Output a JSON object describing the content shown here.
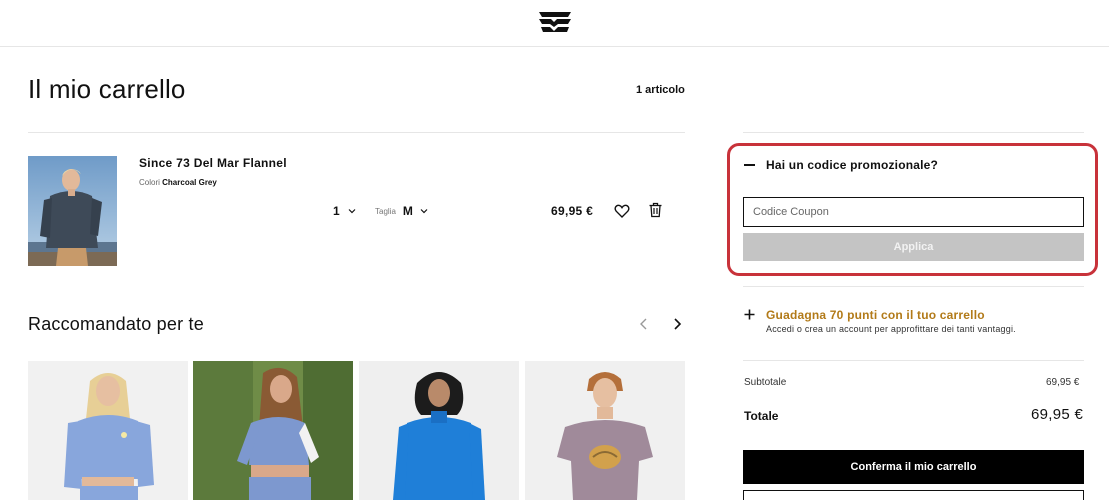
{
  "brand": {
    "logo_icon": "billabong-wave-logo-icon"
  },
  "cart": {
    "title": "Il mio carrello",
    "item_count": "1 articolo"
  },
  "item": {
    "name": "Since 73 Del Mar Flannel",
    "color_label": "Colori",
    "color_value": "Charcoal Grey",
    "quantity": "1",
    "size_label": "Taglia",
    "size_value": "M",
    "price": "69,95 €"
  },
  "recommended": {
    "title": "Raccomandato per te",
    "cards": [
      "rec-card-1",
      "rec-card-2",
      "rec-card-3",
      "rec-card-4"
    ]
  },
  "promo": {
    "title": "Hai un codice promozionale?",
    "input_placeholder": "Codice Coupon",
    "apply_label": "Applica",
    "highlight_color": "#c8323a"
  },
  "points": {
    "title": "Guadagna 70 punti con il tuo carrello",
    "subtitle": "Accedi o crea un account per approfittare dei tanti vantaggi.",
    "accent_color": "#b27a18"
  },
  "summary": {
    "subtotal_label": "Subtotale",
    "subtotal_value": "69,95 €",
    "total_label": "Totale",
    "total_value": "69,95 €"
  },
  "actions": {
    "confirm_label": "Conferma il mio carrello"
  }
}
